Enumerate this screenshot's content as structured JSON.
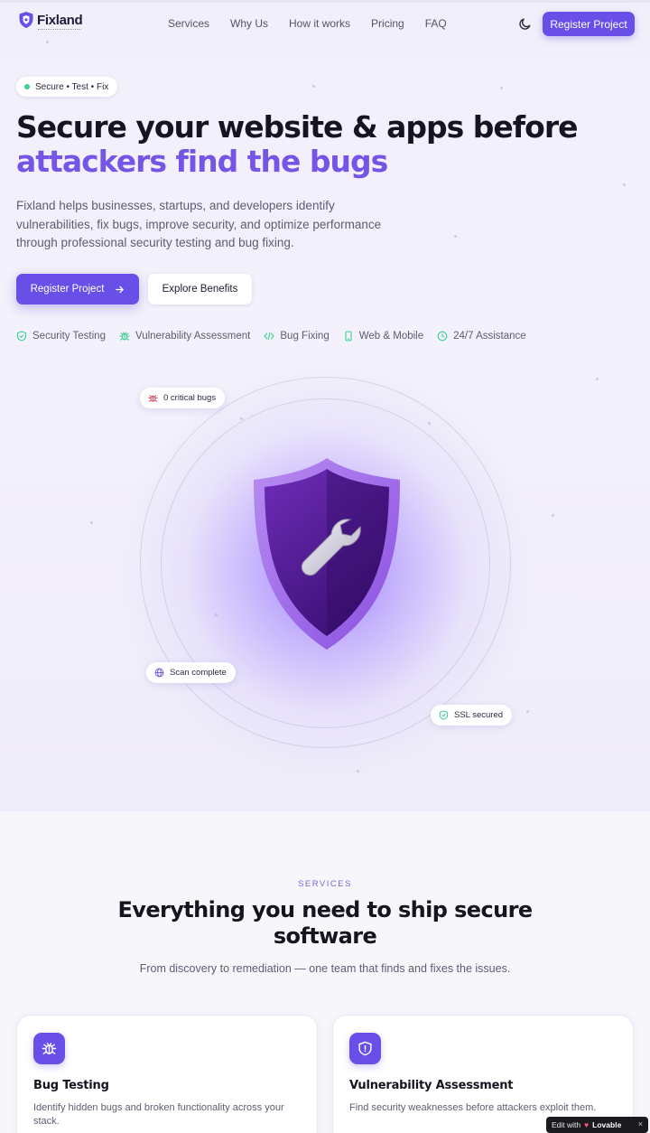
{
  "nav": {
    "brand": "Fixland",
    "links": [
      "Services",
      "Why Us",
      "How it works",
      "Pricing",
      "FAQ"
    ],
    "cta": "Register Project"
  },
  "hero": {
    "badge": "Secure • Test • Fix",
    "title_line1": "Secure your website & apps before",
    "title_line2": "attackers find the bugs",
    "description": "Fixland helps businesses, startups, and developers identify vulnerabilities, fix bugs, improve security, and optimize performance through professional security testing and bug fixing.",
    "primary_button": "Register Project",
    "secondary_button": "Explore Benefits",
    "features": [
      {
        "label": "Security Testing",
        "icon": "shield-check-icon"
      },
      {
        "label": "Vulnerability Assessment",
        "icon": "bug-icon"
      },
      {
        "label": "Bug Fixing",
        "icon": "code-icon"
      },
      {
        "label": "Web & Mobile",
        "icon": "smartphone-icon"
      },
      {
        "label": "24/7 Assistance",
        "icon": "clock-icon"
      }
    ],
    "chips": {
      "critical": "0 critical bugs",
      "scan": "Scan complete",
      "ssl": "SSL secured"
    }
  },
  "services": {
    "eyebrow": "SERVICES",
    "title": "Everything you need to ship secure software",
    "subtitle": "From discovery to remediation — one team that finds and fixes the issues.",
    "cards": [
      {
        "title": "Bug Testing",
        "description": "Identify hidden bugs and broken functionality across your stack.",
        "icon": "bug-icon"
      },
      {
        "title": "Vulnerability Assessment",
        "description": "Find security weaknesses before attackers exploit them.",
        "icon": "shield-alert-icon"
      }
    ]
  },
  "lovable_badge": {
    "prefix": "Edit with",
    "brand": "Lovable",
    "close": "×"
  },
  "colors": {
    "accent": "#6a4ee8",
    "accent_text": "#7555e6",
    "success": "#3ccf91",
    "danger": "#e0435a"
  }
}
